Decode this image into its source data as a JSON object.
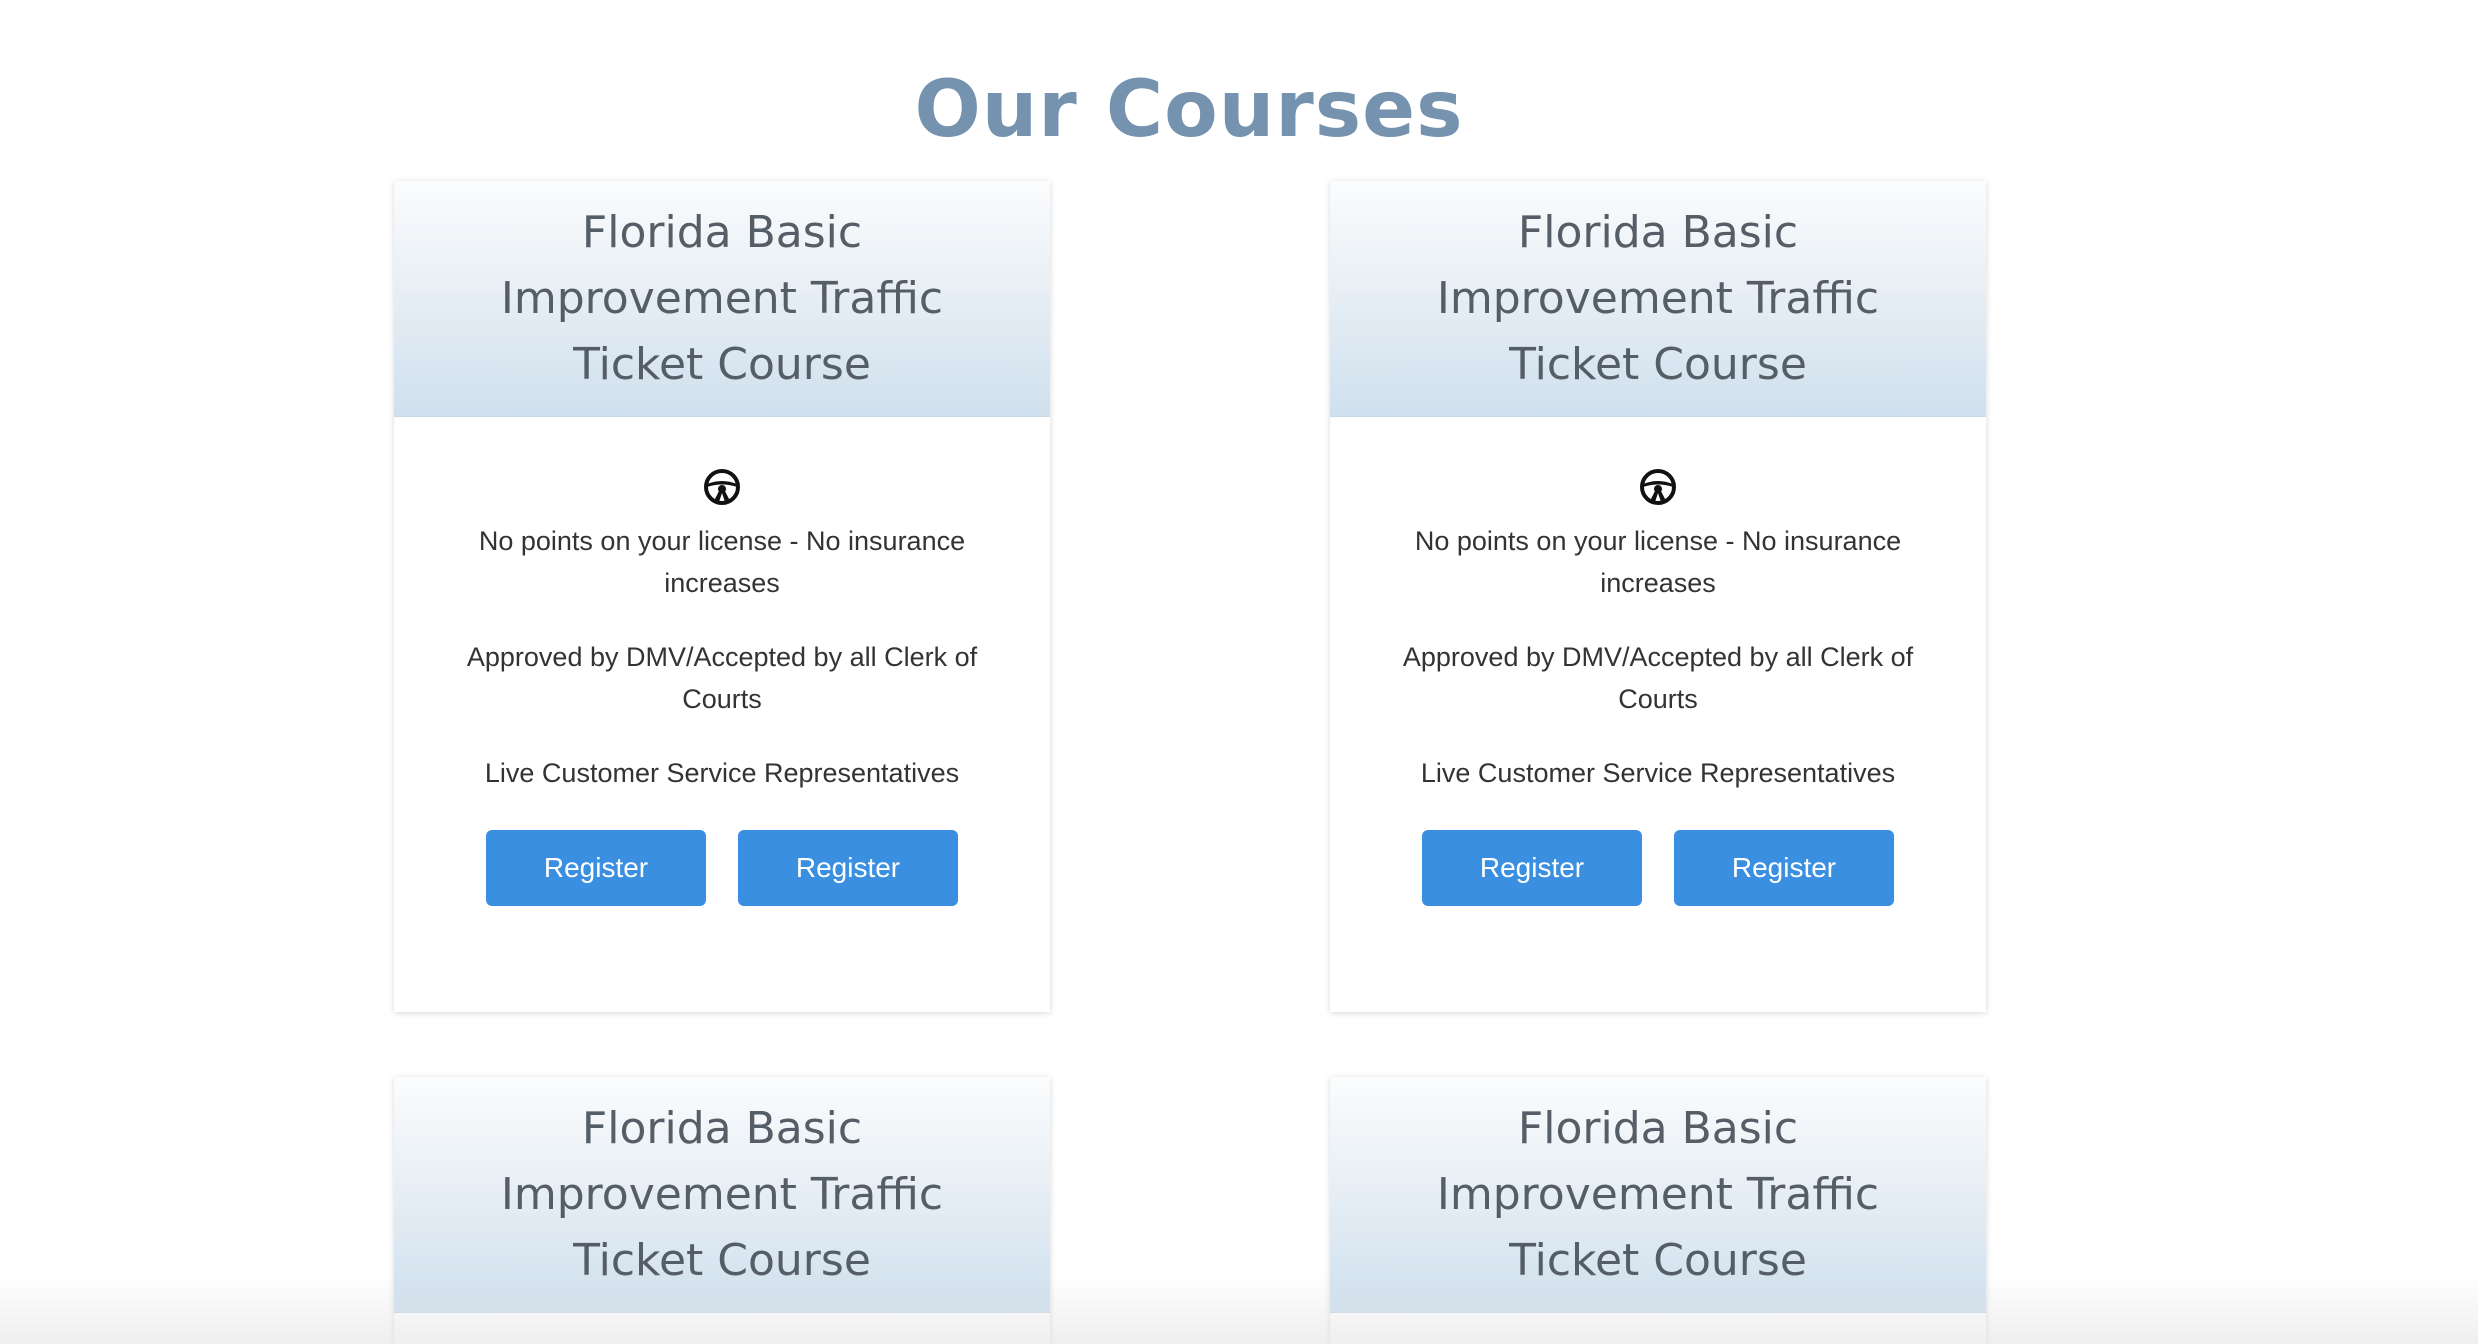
{
  "page": {
    "title": "Our Courses"
  },
  "colors": {
    "title": "#7592ae",
    "header_gradient_top": "#fbfcfd",
    "header_gradient_bottom": "#cfe0ee",
    "button": "#3a8fe0",
    "button_text": "#ffffff",
    "body_text": "#333333"
  },
  "cards": [
    {
      "title": "Florida Basic Improvement Traffic Ticket Course",
      "icon": "steering-wheel-icon",
      "features": [
        "No points on your license - No insurance increases",
        "Approved by DMV/Accepted by all Clerk of Courts",
        "Live Customer Service Representatives"
      ],
      "buttons": [
        "Register",
        "Register"
      ]
    },
    {
      "title": "Florida Basic Improvement Traffic Ticket Course",
      "icon": "steering-wheel-icon",
      "features": [
        "No points on your license - No insurance increases",
        "Approved by DMV/Accepted by all Clerk of Courts",
        "Live Customer Service Representatives"
      ],
      "buttons": [
        "Register",
        "Register"
      ]
    },
    {
      "title": "Florida Basic Improvement Traffic Ticket Course"
    },
    {
      "title": "Florida Basic Improvement Traffic Ticket Course"
    }
  ]
}
